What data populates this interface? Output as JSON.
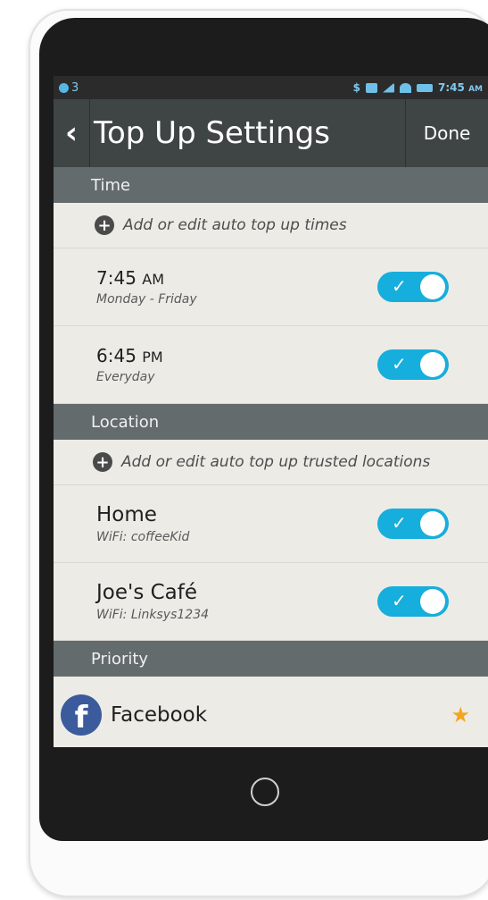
{
  "statusbar": {
    "notification_count": "3",
    "time": "7:45",
    "ampm": "AM",
    "carrier_symbol": "$"
  },
  "header": {
    "back_glyph": "‹",
    "title": "Top Up Settings",
    "done_label": "Done"
  },
  "sections": {
    "time": {
      "header": "Time",
      "add_label": "Add or edit auto top up times",
      "items": [
        {
          "time": "7:45",
          "ampm": "AM",
          "subtitle": "Monday - Friday",
          "enabled": true
        },
        {
          "time": "6:45",
          "ampm": "PM",
          "subtitle": "Everyday",
          "enabled": true
        }
      ]
    },
    "location": {
      "header": "Location",
      "add_label": "Add or edit auto top up trusted locations",
      "items": [
        {
          "name": "Home",
          "subtitle": "WiFi: coffeeKid",
          "enabled": true
        },
        {
          "name": "Joe's Café",
          "subtitle": "WiFi: Linksys1234",
          "enabled": true
        }
      ]
    },
    "priority": {
      "header": "Priority",
      "items": [
        {
          "name": "Facebook",
          "icon": "facebook-icon",
          "starred": true
        }
      ]
    }
  },
  "colors": {
    "toggle_on": "#16aedc",
    "header_bg": "#3f4445",
    "section_bg": "#646b6c",
    "star": "#f6a51b",
    "facebook": "#3b5b9c"
  },
  "toggle_check_glyph": "✓",
  "star_glyph": "★"
}
